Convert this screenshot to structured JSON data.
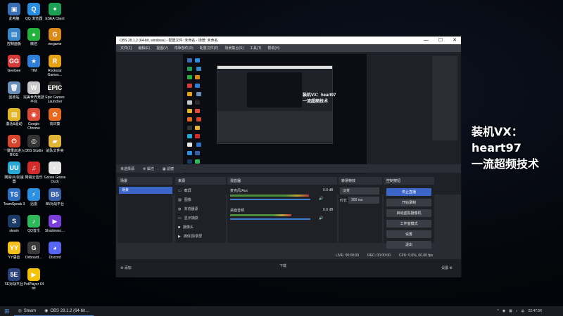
{
  "desktop_icons": [
    {
      "label": "此电脑",
      "color": "#3b6fb3",
      "glyph": "▣"
    },
    {
      "label": "QQ 浏览器",
      "color": "#2b8de0",
      "glyph": "Q"
    },
    {
      "label": "ESEA Client",
      "color": "#1f9e57",
      "glyph": "✦"
    },
    {
      "label": "控制面板",
      "color": "#3a86c7",
      "glyph": "▤"
    },
    {
      "label": "微信",
      "color": "#26b03d",
      "glyph": "●"
    },
    {
      "label": "wegame",
      "color": "#d88a1b",
      "glyph": "G"
    },
    {
      "label": "GeeGee",
      "color": "#d63a3a",
      "glyph": "GG"
    },
    {
      "label": "TIM",
      "color": "#2f7fd6",
      "glyph": "★"
    },
    {
      "label": "Rockstar Games…",
      "color": "#e5a31a",
      "glyph": "R"
    },
    {
      "label": "回收站",
      "color": "#6a8fb8",
      "glyph": "🗑"
    },
    {
      "label": "完美世界竞技平台",
      "color": "#c9c9c9",
      "glyph": "W"
    },
    {
      "label": "Epic Games Launcher",
      "color": "#2a2a2a",
      "glyph": "EPIC"
    },
    {
      "label": "激活&驱动",
      "color": "#e2b52b",
      "glyph": "▧"
    },
    {
      "label": "Google Chrome",
      "color": "#dd4b39",
      "glyph": "◉"
    },
    {
      "label": "向日葵",
      "color": "#e56a1f",
      "glyph": "✿"
    },
    {
      "label": "一键重启进入BIOS",
      "color": "#d5462d",
      "glyph": "⏻"
    },
    {
      "label": "OBS Studio",
      "color": "#333",
      "glyph": "◎"
    },
    {
      "label": "战队文件夹",
      "color": "#e3b43a",
      "glyph": "▰"
    },
    {
      "label": "网易UU加速器",
      "color": "#2aa8d6",
      "glyph": "UU"
    },
    {
      "label": "网易云音乐",
      "color": "#d22c2c",
      "glyph": "♫"
    },
    {
      "label": "Goose Goose Duck",
      "color": "#e6e6e6",
      "glyph": "◐"
    },
    {
      "label": "TeamSpeak 3",
      "color": "#2e6fbf",
      "glyph": "TS"
    },
    {
      "label": "迅雷",
      "color": "#2d8fe0",
      "glyph": "⚡"
    },
    {
      "label": "B5对战平台",
      "color": "#385fa8",
      "glyph": "B5"
    },
    {
      "label": "steam",
      "color": "#1b3a66",
      "glyph": "S"
    },
    {
      "label": "QQ音乐",
      "color": "#2fb95a",
      "glyph": "♪"
    },
    {
      "label": "Shadowso…",
      "color": "#7a3fd6",
      "glyph": "▶"
    },
    {
      "label": "YY语音",
      "color": "#f4c01e",
      "glyph": "YY"
    },
    {
      "label": "Onboard…",
      "color": "#3a3a3a",
      "glyph": "G"
    },
    {
      "label": "Discord",
      "color": "#5865f2",
      "glyph": "◕"
    },
    {
      "label": "5E对战平台",
      "color": "#2b3f7a",
      "glyph": "5E"
    },
    {
      "label": "PotPlayer 64 bit",
      "color": "#f2c20d",
      "glyph": "▶"
    }
  ],
  "overlay_text": [
    "装机VX：heart97",
    "一流超频技术"
  ],
  "obs": {
    "title": "OBS 28.1.2 (64-bit, windows) - 配置文件: 未命名 - 场景: 未命名",
    "menu": [
      "文件(F)",
      "编辑(E)",
      "视图(V)",
      "停靠部件(D)",
      "配置文件(P)",
      "场景集合(S)",
      "工具(T)",
      "帮助(H)"
    ],
    "preview_inner_text": [
      "装机VX：heart97",
      "一流超频技术"
    ],
    "source_bar": {
      "no_source": "未选择源",
      "properties": "属性",
      "filters": "滤镜"
    },
    "panels": {
      "scenes": "场景",
      "sources": "来源",
      "mixer": "混音器",
      "transitions": "转场特效",
      "controls": "控制按钮"
    },
    "scene_item": "场景",
    "sources": [
      "截屏",
      "图像",
      "浏览器源",
      "显示捕获",
      "摄像头",
      "媒体源/录屏"
    ],
    "mixer": [
      {
        "name": "麦克风/Aux",
        "db": "0.0 dB",
        "meter": 0.8,
        "volume": 0.95
      },
      {
        "name": "桌面音频",
        "db": "0.0 dB",
        "meter": 0.62,
        "volume": 0.95
      }
    ],
    "transition": {
      "type": "淡变",
      "duration_label": "时长",
      "duration": "300 ms"
    },
    "controls": [
      "停止直播",
      "开始录制",
      "启动虚拟摄像机",
      "工作室模式",
      "设置",
      "退出"
    ],
    "status": {
      "live": "LIVE: 00:00:00",
      "rec": "REC: 00:00:00",
      "cpu": "CPU: 0.0%, 60.00 fps"
    },
    "bottom": {
      "add": "添加",
      "downloads": "下载",
      "settings": "设置"
    }
  },
  "taskbar": {
    "items": [
      "Steam",
      "OBS 28.1.2 (64-bit…"
    ],
    "time": "22:47:56"
  }
}
